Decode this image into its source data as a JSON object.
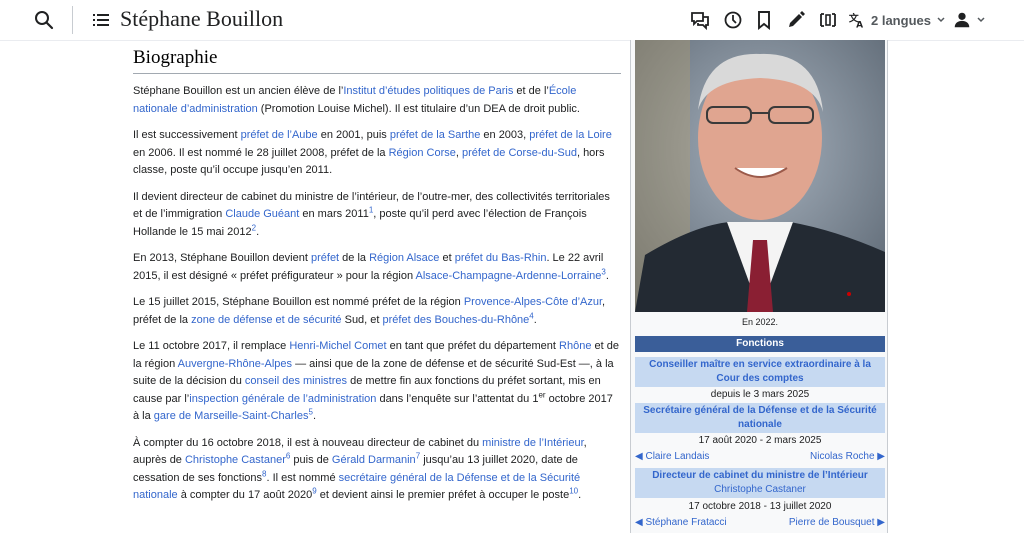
{
  "header": {
    "title": "Stéphane Bouillon",
    "languages_label": "2 langues",
    "icons": [
      "search-icon",
      "toc-icon",
      "talk-icon",
      "history-icon",
      "watch-icon",
      "edit-icon",
      "width-icon",
      "translate-icon",
      "user-icon"
    ]
  },
  "section": {
    "heading": "Biographie"
  },
  "paragraphs": [
    {
      "runs": [
        {
          "t": "Stéphane Bouillon est un ancien élève de l’"
        },
        {
          "t": "Institut d’études politiques de Paris",
          "link": true
        },
        {
          "t": " et de l’"
        },
        {
          "t": "École nationale d’administration",
          "link": true
        },
        {
          "t": " (Promotion Louise Michel). Il est titulaire d’un DEA de droit public."
        }
      ]
    },
    {
      "runs": [
        {
          "t": "Il est successivement "
        },
        {
          "t": "préfet de l’Aube",
          "link": true
        },
        {
          "t": " en 2001, puis "
        },
        {
          "t": "préfet de la Sarthe",
          "link": true
        },
        {
          "t": " en 2003, "
        },
        {
          "t": "préfet de la Loire",
          "link": true
        },
        {
          "t": " en 2006. Il est nommé le 28 juillet 2008, préfet de la "
        },
        {
          "t": "Région Corse",
          "link": true
        },
        {
          "t": ", "
        },
        {
          "t": "préfet de Corse-du-Sud",
          "link": true
        },
        {
          "t": ", hors classe, poste qu’il occupe jusqu’en 2011."
        }
      ]
    },
    {
      "runs": [
        {
          "t": "Il devient directeur de cabinet du ministre de l’intérieur, de l’outre-mer, des collectivités territoriales et de l’immigration "
        },
        {
          "t": "Claude Guéant",
          "link": true
        },
        {
          "t": " en mars 2011"
        },
        {
          "t": "1",
          "sup": true
        },
        {
          "t": ", poste qu’il perd avec l’élection de François Hollande le 15 mai 2012"
        },
        {
          "t": "2",
          "sup": true
        },
        {
          "t": "."
        }
      ]
    },
    {
      "runs": [
        {
          "t": "En 2013, Stéphane Bouillon devient "
        },
        {
          "t": "préfet",
          "link": true
        },
        {
          "t": " de la "
        },
        {
          "t": "Région Alsace",
          "link": true
        },
        {
          "t": " et "
        },
        {
          "t": "préfet du Bas-Rhin",
          "link": true
        },
        {
          "t": ". Le 22 avril 2015, il est désigné « préfet préfigurateur » pour la région "
        },
        {
          "t": "Alsace-Champagne-Ardenne-Lorraine",
          "link": true
        },
        {
          "t": "3",
          "sup": true
        },
        {
          "t": "."
        }
      ]
    },
    {
      "runs": [
        {
          "t": "Le 15 juillet 2015, Stéphane Bouillon est nommé préfet de la région "
        },
        {
          "t": "Provence-Alpes-Côte d’Azur",
          "link": true
        },
        {
          "t": ", préfet de la "
        },
        {
          "t": "zone de défense et de sécurité",
          "link": true
        },
        {
          "t": " Sud, et "
        },
        {
          "t": "préfet des Bouches-du-Rhône",
          "link": true
        },
        {
          "t": "4",
          "sup": true
        },
        {
          "t": "."
        }
      ]
    },
    {
      "runs": [
        {
          "t": "Le 11 octobre 2017, il remplace "
        },
        {
          "t": "Henri-Michel Comet",
          "link": true
        },
        {
          "t": " en tant que préfet du département "
        },
        {
          "t": "Rhône",
          "link": true
        },
        {
          "t": " et de la région "
        },
        {
          "t": "Auvergne-Rhône-Alpes",
          "link": true
        },
        {
          "t": " — ainsi que de la zone de défense et de sécurité Sud-Est —, à la suite de la décision du "
        },
        {
          "t": "conseil des ministres",
          "link": true
        },
        {
          "t": " de mettre fin aux fonctions du préfet sortant, mis en cause par l’"
        },
        {
          "t": "inspection générale de l’administration",
          "link": true
        },
        {
          "t": " dans l’enquête sur l’attentat du 1"
        },
        {
          "t": "er",
          "sup": true,
          "plain": true
        },
        {
          "t": " octobre 2017 à la "
        },
        {
          "t": "gare de Marseille-Saint-Charles",
          "link": true
        },
        {
          "t": "5",
          "sup": true
        },
        {
          "t": "."
        }
      ]
    },
    {
      "runs": [
        {
          "t": "À compter du 16 octobre 2018, il est à nouveau directeur de cabinet du "
        },
        {
          "t": "ministre de l’Intérieur",
          "link": true
        },
        {
          "t": ", auprès de "
        },
        {
          "t": "Christophe Castaner",
          "link": true
        },
        {
          "t": "6",
          "sup": true
        },
        {
          "t": " puis de "
        },
        {
          "t": "Gérald Darmanin",
          "link": true
        },
        {
          "t": "7",
          "sup": true
        },
        {
          "t": " jusqu’au 13 juillet 2020, date de cessation de ses fonctions"
        },
        {
          "t": "8",
          "sup": true
        },
        {
          "t": ". Il est nommé "
        },
        {
          "t": "secrétaire général de la Défense et de la Sécurité nationale",
          "link": true
        },
        {
          "t": " à compter du 17 août 2020"
        },
        {
          "t": "9",
          "sup": true
        },
        {
          "t": " et devient ainsi le premier préfet à occuper le poste"
        },
        {
          "t": "10",
          "sup": true
        },
        {
          "t": "."
        }
      ]
    }
  ],
  "infobox": {
    "caption": "En 2022.",
    "functions_header": "Fonctions",
    "role1": "Conseiller maître en service extraordinaire à la Cour des comptes",
    "role1_dates": "depuis le 3 mars 2025",
    "role2": "Secrétaire général de la Défense et de la Sécurité nationale",
    "role2_dates": "17 août 2020 - 2 mars 2025",
    "role2_prev": "Claire Landais",
    "role2_next": "Nicolas Roche",
    "role3": "Directeur de cabinet du ministre de l’Intérieur",
    "role3_minister": "Christophe Castaner",
    "role3_dates": "17 octobre 2018 - 13 juillet 2020",
    "role3_prev": "Stéphane Fratacci",
    "role3_next": "Pierre de Bousquet"
  },
  "colors": {
    "link": "#3366cc",
    "band_dark": "#3a5e99",
    "band_light": "#c6d9f1"
  }
}
